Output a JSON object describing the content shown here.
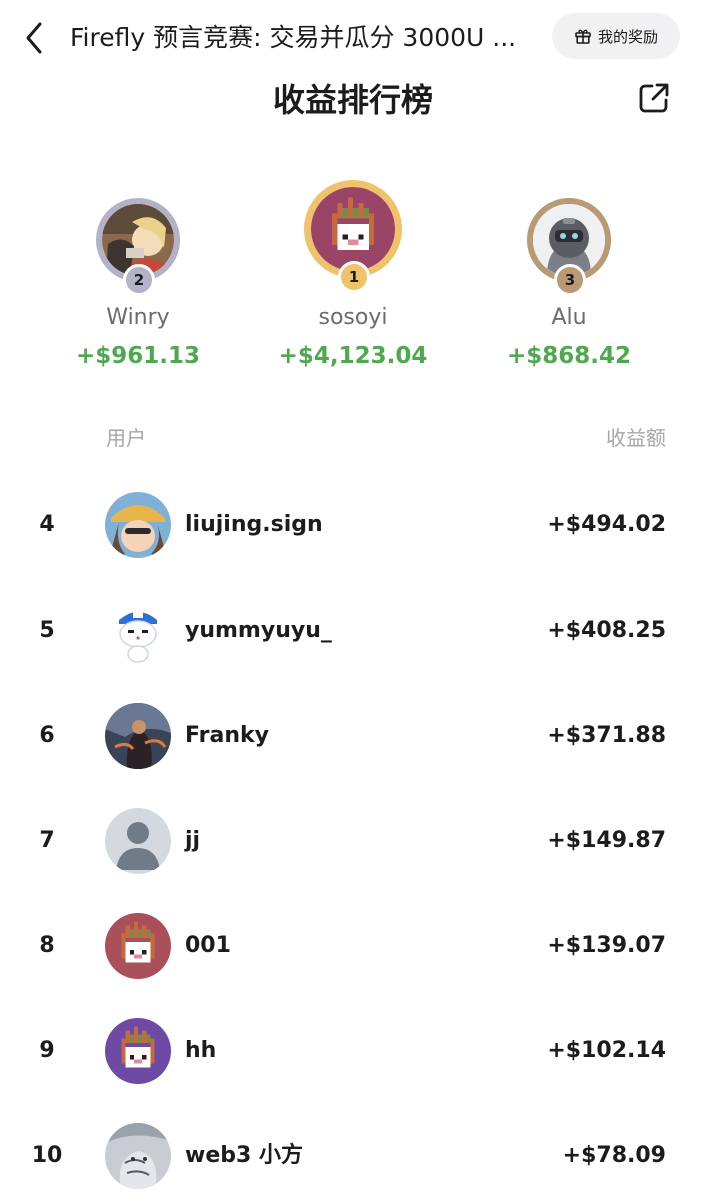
{
  "header": {
    "title": "Firefly 预言竞赛: 交易并瓜分 3000U ...",
    "reward_label": "我的奖励",
    "board_title": "收益排行榜"
  },
  "podium": [
    {
      "rank": "2",
      "name": "Winry",
      "amount": "+$961.13",
      "ring_color": "#b3b2c8",
      "badge_color": "#b3b2c8",
      "avatar": "anime-avatar"
    },
    {
      "rank": "1",
      "name": "sosoyi",
      "amount": "+$4,123.04",
      "ring_color": "#f0c36a",
      "badge_color": "#f0c36a",
      "avatar": "pixel-flame-avatar"
    },
    {
      "rank": "3",
      "name": "Alu",
      "amount": "+$868.42",
      "ring_color": "#b89a74",
      "badge_color": "#b89a74",
      "avatar": "robot-avatar"
    }
  ],
  "columns": {
    "user": "用户",
    "earnings": "收益额"
  },
  "rows": [
    {
      "rank": "4",
      "name": "liujing.sign",
      "amount": "+$494.02",
      "avatar": "anime-avatar"
    },
    {
      "rank": "5",
      "name": "yummyuyu_",
      "amount": "+$408.25",
      "avatar": "cat-avatar"
    },
    {
      "rank": "6",
      "name": "Franky",
      "amount": "+$371.88",
      "avatar": "artwork-avatar"
    },
    {
      "rank": "7",
      "name": "jj",
      "amount": "+$149.87",
      "avatar": "default-avatar"
    },
    {
      "rank": "8",
      "name": "001",
      "amount": "+$139.07",
      "avatar": "pixel-flame-avatar"
    },
    {
      "rank": "9",
      "name": "hh",
      "amount": "+$102.14",
      "avatar": "pixel-flame-avatar"
    },
    {
      "rank": "10",
      "name": "web3 小方",
      "amount": "+$78.09",
      "avatar": "sketch-avatar"
    }
  ],
  "colors": {
    "accent_green": "#4fa84f",
    "flame_bg_rose": "#a9505b",
    "flame_bg_purple": "#6d4aa6",
    "flame_bg_plum": "#9a4468"
  }
}
